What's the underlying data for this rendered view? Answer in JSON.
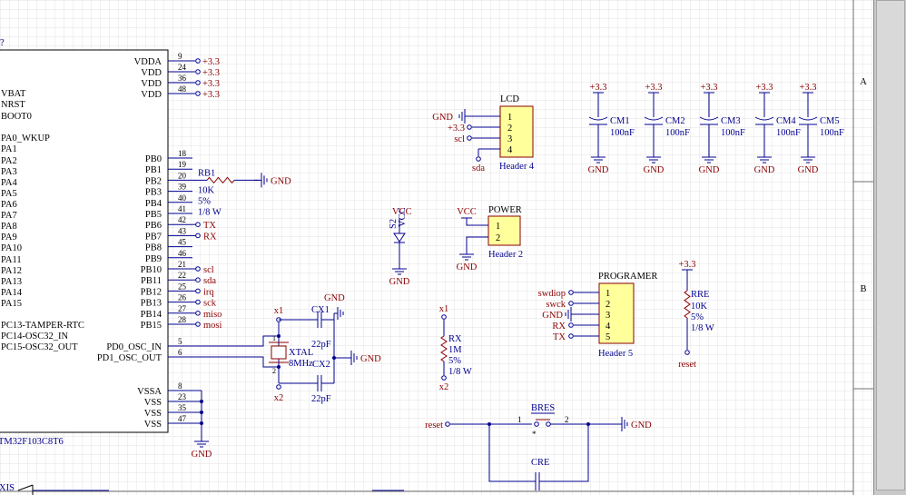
{
  "app": {
    "name": "Schematic Editor"
  },
  "colors": {
    "paper": "#ffffff",
    "grid": "#dedede",
    "wire": "#000090",
    "comp_fill": "#ffff9b",
    "body_line": "#8b0000",
    "text_dark": "#000000",
    "text_blue": "#000090",
    "power_red": "#8b0000",
    "net_red": "#8b0000",
    "border": "#6f6f6f"
  },
  "border": {
    "rows": [
      "A",
      "B"
    ]
  },
  "mcu": {
    "designator_partial": "?",
    "part_partial": "TM32F103C8T6",
    "left_pins": [
      "VBAT",
      "NRST",
      "BOOT0",
      "PA0_WKUP",
      "PA1",
      "PA2",
      "PA3",
      "PA4",
      "PA5",
      "PA6",
      "PA7",
      "PA8",
      "PA9",
      "PA10",
      "PA11",
      "PA12",
      "PA13",
      "PA14",
      "PA15",
      "PC13-TAMPER-RTC",
      "PC14-OSC32_IN",
      "PC15-OSC32_OUT"
    ],
    "right_top": [
      {
        "name": "VDDA",
        "num": "9",
        "net": "+3.3"
      },
      {
        "name": "VDD",
        "num": "24",
        "net": "+3.3"
      },
      {
        "name": "VDD",
        "num": "36",
        "net": "+3.3"
      },
      {
        "name": "VDD",
        "num": "48",
        "net": "+3.3"
      }
    ],
    "right_pb": [
      {
        "name": "PB0",
        "num": "18"
      },
      {
        "name": "PB1",
        "num": "19"
      },
      {
        "name": "PB2",
        "num": "20"
      },
      {
        "name": "PB3",
        "num": "39"
      },
      {
        "name": "PB4",
        "num": "40"
      },
      {
        "name": "PB5",
        "num": "41"
      },
      {
        "name": "PB6",
        "num": "42",
        "net": "TX"
      },
      {
        "name": "PB7",
        "num": "43",
        "net": "RX"
      },
      {
        "name": "PB8",
        "num": "45"
      },
      {
        "name": "PB9",
        "num": "46"
      },
      {
        "name": "PB10",
        "num": "21",
        "net": "scl"
      },
      {
        "name": "PB11",
        "num": "22",
        "net": "sda"
      },
      {
        "name": "PB12",
        "num": "25",
        "net": "irq"
      },
      {
        "name": "PB13",
        "num": "26",
        "net": "sck"
      },
      {
        "name": "PB14",
        "num": "27",
        "net": "miso"
      },
      {
        "name": "PB15",
        "num": "28",
        "net": "mosi"
      }
    ],
    "osc_pins": [
      {
        "name": "PD0_OSC_IN",
        "num": "5"
      },
      {
        "name": "PD1_OSC_OUT",
        "num": "6"
      }
    ],
    "vss_pins": [
      {
        "name": "VSSA",
        "num": "8"
      },
      {
        "name": "VSS",
        "num": "23"
      },
      {
        "name": "VSS",
        "num": "35"
      },
      {
        "name": "VSS",
        "num": "47"
      }
    ],
    "gnd": "GND"
  },
  "rb1": {
    "designator": "RB1",
    "value": "10K",
    "tolerance": "5%",
    "power": "1/8 W",
    "net": "GND"
  },
  "crystal": {
    "x1": "x1",
    "x2": "x2",
    "xtal": "XTAL",
    "freq": "8MHz",
    "cx1": "CX1",
    "cx2": "CX2",
    "cap": "22pF",
    "gnd_top": "GND",
    "gnd_right": "GND",
    "pin1": "1",
    "pin2": "2"
  },
  "led": {
    "designator": "S2",
    "value": "VCC",
    "gnd": "GND"
  },
  "rx_res": {
    "x1": "x1",
    "designator": "RX",
    "value": "1M",
    "tolerance": "5%",
    "power": "1/8 W",
    "x2": "x2"
  },
  "lcd": {
    "designator": "LCD",
    "part": "Header 4",
    "nets": [
      "GND",
      "+3.3",
      "scl",
      "sda"
    ],
    "pins": [
      "1",
      "2",
      "3",
      "4"
    ]
  },
  "power_hdr": {
    "designator": "POWER",
    "part": "Header 2",
    "vcc": "VCC",
    "gnd": "GND",
    "pins": [
      "1",
      "2"
    ]
  },
  "caps": {
    "net_top": "+3.3",
    "gnd": "GND",
    "value": "100nF",
    "names": [
      "CM1",
      "CM2",
      "CM3",
      "CM4",
      "CM5"
    ]
  },
  "programer": {
    "designator": "PROGRAMER",
    "part": "Header 5",
    "nets": [
      "swdiop",
      "swck",
      "GND",
      "RX",
      "TX"
    ],
    "pins": [
      "1",
      "2",
      "3",
      "4",
      "5"
    ]
  },
  "rre": {
    "net_top": "+3.3",
    "designator": "RRE",
    "value": "10K",
    "tolerance": "5%",
    "power": "1/8 W",
    "net_bottom": "reset"
  },
  "bres": {
    "designator": "BRES",
    "net": "reset",
    "gnd": "GND",
    "pin1": "1",
    "pin2": "2",
    "mark": "*",
    "cap": "CRE"
  },
  "bottom": {
    "partial": "XIS"
  }
}
